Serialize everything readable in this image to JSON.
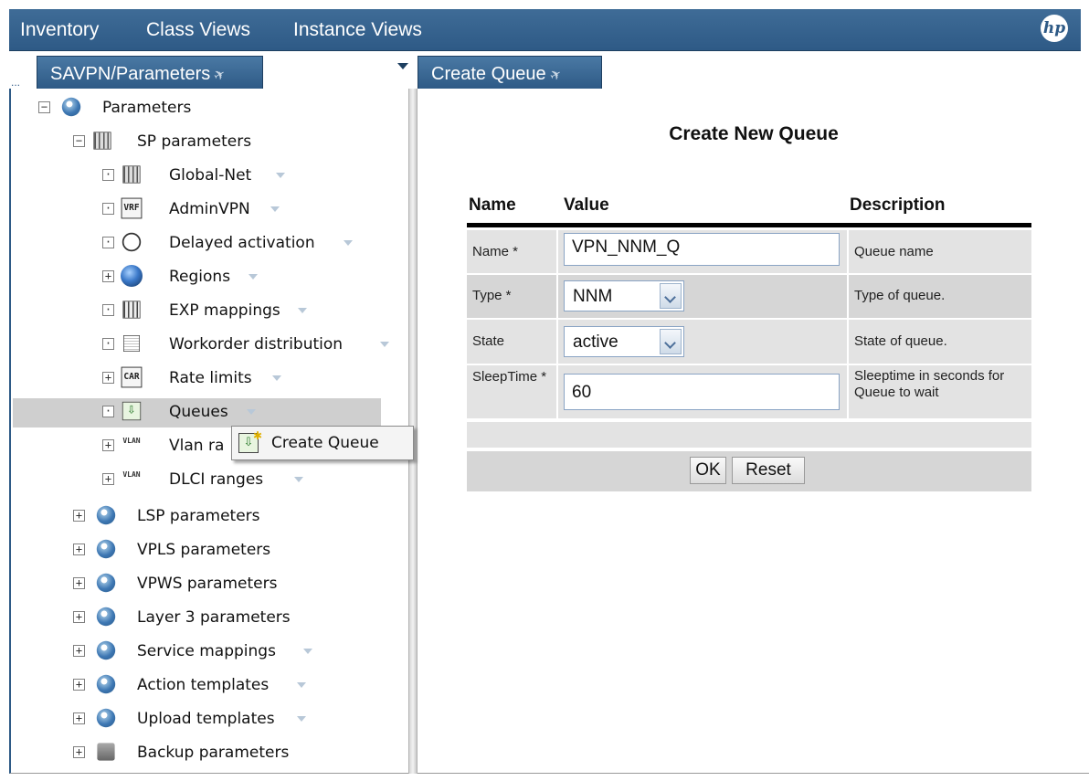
{
  "topnav": {
    "items": [
      "Inventory",
      "Class Views",
      "Instance Views"
    ],
    "logo": "hp"
  },
  "tabs": {
    "left": {
      "label": "SAVPN/Parameters",
      "icon": "pin-icon",
      "ellipsis": "..."
    },
    "right": {
      "label": "Create Queue",
      "icon": "pin-icon"
    }
  },
  "tree": {
    "root": {
      "label": "Parameters",
      "icon": "gear-icon",
      "toggle": "−"
    },
    "sp": {
      "label": "SP parameters",
      "icon": "table-icon",
      "toggle": "−"
    },
    "sp_children": [
      {
        "label": "Global-Net",
        "icon": "table-icon",
        "toggle": "·",
        "has_menu": true
      },
      {
        "label": "AdminVPN",
        "icon": "vrf-icon",
        "icon_text": "VRF",
        "toggle": "·",
        "has_menu": true
      },
      {
        "label": "Delayed activation",
        "icon": "clock-icon",
        "toggle": "·",
        "has_menu": true
      },
      {
        "label": "Regions",
        "icon": "globe-icon",
        "toggle": "+",
        "has_menu": true
      },
      {
        "label": "EXP mappings",
        "icon": "grid-icon",
        "toggle": "·",
        "has_menu": true
      },
      {
        "label": "Workorder distribution",
        "icon": "document-icon",
        "toggle": "·",
        "has_menu": true
      },
      {
        "label": "Rate limits",
        "icon": "car-icon",
        "icon_text": "CAR",
        "toggle": "+",
        "has_menu": true
      },
      {
        "label": "Queues",
        "icon": "queue-icon",
        "toggle": "·",
        "has_menu": true,
        "selected": true
      },
      {
        "label": "Vlan ra",
        "icon": "vlan-icon",
        "icon_text": "VLAN",
        "toggle": "+",
        "has_menu": false
      },
      {
        "label": "DLCI ranges",
        "icon": "vlan-icon",
        "icon_text": "VLAN",
        "toggle": "+",
        "has_menu": true
      }
    ],
    "top_children": [
      {
        "label": "LSP parameters",
        "icon": "gear-icon",
        "toggle": "+",
        "has_menu": false
      },
      {
        "label": "VPLS parameters",
        "icon": "gear-icon",
        "toggle": "+",
        "has_menu": false
      },
      {
        "label": "VPWS parameters",
        "icon": "gear-icon",
        "toggle": "+",
        "has_menu": false
      },
      {
        "label": "Layer 3 parameters",
        "icon": "gear-icon",
        "toggle": "+",
        "has_menu": false
      },
      {
        "label": "Service mappings",
        "icon": "gear-icon",
        "toggle": "+",
        "has_menu": true
      },
      {
        "label": "Action templates",
        "icon": "gear-icon",
        "toggle": "+",
        "has_menu": true
      },
      {
        "label": "Upload templates",
        "icon": "gear-icon",
        "toggle": "+",
        "has_menu": true
      },
      {
        "label": "Backup parameters",
        "icon": "backup-icon",
        "toggle": "+",
        "has_menu": false
      }
    ]
  },
  "context_menu": {
    "label": "Create Queue",
    "icon": "create-queue-icon"
  },
  "form": {
    "title": "Create New Queue",
    "headers": {
      "name": "Name",
      "value": "Value",
      "description": "Description"
    },
    "fields": [
      {
        "label": "Name *",
        "type": "text",
        "value": "VPN_NNM_Q",
        "description": "Queue name"
      },
      {
        "label": "Type *",
        "type": "select",
        "value": "NNM",
        "description": "Type of queue."
      },
      {
        "label": "State",
        "type": "select",
        "value": "active",
        "description": "State of queue."
      },
      {
        "label": "SleepTime *",
        "type": "text",
        "value": "60",
        "description": "Sleeptime in seconds for Queue to wait"
      }
    ],
    "buttons": {
      "ok": "OK",
      "reset": "Reset"
    }
  },
  "colors": {
    "nav_bg": "#2e5a86",
    "row_selected": "#cfcfcf",
    "form_cell": "#e3e3e3"
  }
}
